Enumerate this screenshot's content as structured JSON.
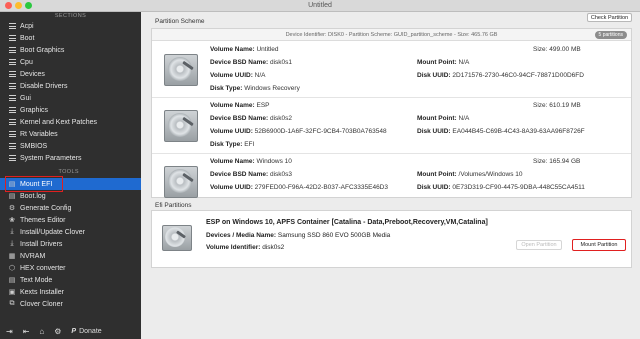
{
  "window": {
    "title": "Untitled"
  },
  "sidebar": {
    "sections_heading": "SECTIONS",
    "tools_heading": "TOOLS",
    "sections": [
      {
        "label": "Acpi"
      },
      {
        "label": "Boot"
      },
      {
        "label": "Boot Graphics"
      },
      {
        "label": "Cpu"
      },
      {
        "label": "Devices"
      },
      {
        "label": "Disable Drivers"
      },
      {
        "label": "Gui"
      },
      {
        "label": "Graphics"
      },
      {
        "label": "Kernel and Kext Patches"
      },
      {
        "label": "Rt Variables"
      },
      {
        "label": "SMBIOS"
      },
      {
        "label": "System Parameters"
      }
    ],
    "tools": [
      {
        "label": "Mount EFI",
        "icon": "drive-icon",
        "selected": true
      },
      {
        "label": "Boot.log",
        "icon": "document-icon"
      },
      {
        "label": "Generate Config",
        "icon": "gear-icon"
      },
      {
        "label": "Themes Editor",
        "icon": "palette-icon"
      },
      {
        "label": "Install/Update Clover",
        "icon": "download-icon"
      },
      {
        "label": "Install Drivers",
        "icon": "download-icon"
      },
      {
        "label": "NVRAM",
        "icon": "chip-icon"
      },
      {
        "label": "HEX converter",
        "icon": "hex-icon"
      },
      {
        "label": "Text Mode",
        "icon": "text-icon"
      },
      {
        "label": "Kexts Installer",
        "icon": "package-icon"
      },
      {
        "label": "Clover Cloner",
        "icon": "copy-icon"
      }
    ],
    "bottom": {
      "donate_label": "Donate"
    }
  },
  "partition_scheme": {
    "label": "Partition Scheme",
    "check_button": "Check Partition",
    "header": "Device Identifier: DISK0 - Partition Scheme: GUID_partition_scheme - Size: 465.76 GB",
    "badge": "5 partitions",
    "partitions": [
      {
        "volume_name_label": "Volume Name:",
        "volume_name": "Untitled",
        "size_label": "Size:",
        "size": "499.00 MB",
        "bsd_label": "Device BSD Name:",
        "bsd": "disk0s1",
        "mount_label": "Mount Point:",
        "mount": "N/A",
        "vuuid_label": "Volume UUID:",
        "vuuid": "N/A",
        "duuid_label": "Disk UUID:",
        "duuid": "2D171576-2730-46C0-94CF-78871D00D6FD",
        "type_label": "Disk Type:",
        "type": "Windows Recovery"
      },
      {
        "volume_name_label": "Volume Name:",
        "volume_name": "ESP",
        "size_label": "Size:",
        "size": "610.19 MB",
        "bsd_label": "Device BSD Name:",
        "bsd": "disk0s2",
        "mount_label": "Mount Point:",
        "mount": "N/A",
        "vuuid_label": "Volume UUID:",
        "vuuid": "52B6900D-1A6F-32FC-9CB4-703B0A763548",
        "duuid_label": "Disk UUID:",
        "duuid": "EA044B45-C69B-4C43-8A39-63AA96F8726F",
        "type_label": "Disk Type:",
        "type": "EFI"
      },
      {
        "volume_name_label": "Volume Name:",
        "volume_name": "Windows 10",
        "size_label": "Size:",
        "size": "165.94 GB",
        "bsd_label": "Device BSD Name:",
        "bsd": "disk0s3",
        "mount_label": "Mount Point:",
        "mount": "/Volumes/Windows 10",
        "vuuid_label": "Volume UUID:",
        "vuuid": "279FED00-F96A-42D2-B037-AFC3335E46D3",
        "duuid_label": "Disk UUID:",
        "duuid": "0E73D319-CF90-4475-9DBA-448C55CA4511"
      }
    ]
  },
  "efi_partitions": {
    "label": "Efi Partitions",
    "title": "ESP on Windows 10, APFS Container [Catalina - Data,Preboot,Recovery,VM,Catalina]",
    "media_label": "Devices / Media Name:",
    "media": "Samsung SSD 860 EVO 500GB Media",
    "vid_label": "Volume Identifier:",
    "vid": "disk0s2",
    "open_button": "Open Partition",
    "mount_button": "Mount Partition"
  },
  "colors": {
    "sidebar_bg": "#2f2f2f",
    "selected": "#1f6ad0",
    "highlight_box": "#e02020"
  }
}
